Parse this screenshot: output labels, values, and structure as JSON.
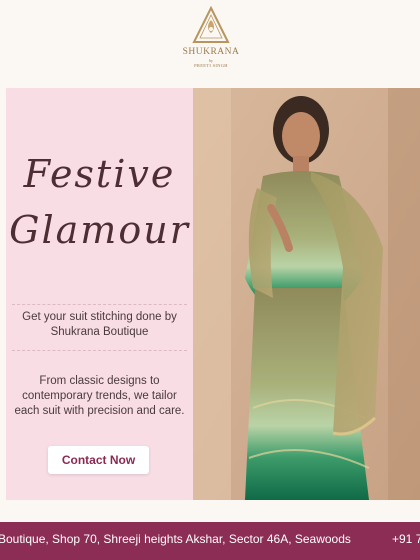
{
  "brand": {
    "name": "SHUKRANA",
    "by": "by",
    "owner": "PREETI SINGH",
    "accent_color": "#9c7a4a"
  },
  "hero": {
    "title_line1": "Festive",
    "title_line2": "Glamour",
    "tagline": "Get your suit stitching done by Shukrana Boutique",
    "description": "From classic designs to contemporary trends, we tailor each suit with precision and care.",
    "cta_label": "Contact Now",
    "panel_color": "#f8dde5",
    "cta_text_color": "#8a2a52"
  },
  "photo": {
    "subject": "model in green embroidered suit with dupatta"
  },
  "footer": {
    "address": "Boutique, Shop 70, Shreeji heights Akshar, Sector 46A, Seawoods",
    "phone": "+91 7",
    "background_color": "#8c2d55"
  }
}
